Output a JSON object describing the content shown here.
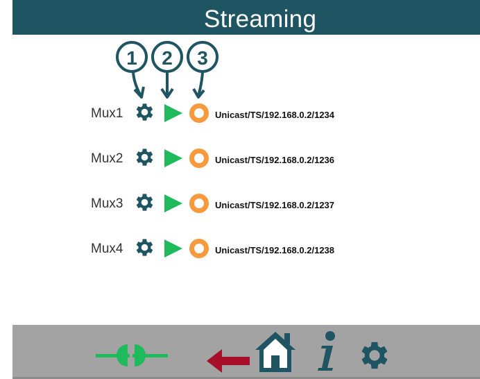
{
  "header": {
    "title": "Streaming"
  },
  "callouts": [
    "1",
    "2",
    "3"
  ],
  "rows": [
    {
      "label": "Mux1",
      "url": "Unicast/TS/192.168.0.2/1234"
    },
    {
      "label": "Mux2",
      "url": "Unicast/TS/192.168.0.2/1236"
    },
    {
      "label": "Mux3",
      "url": "Unicast/TS/192.168.0.2/1237"
    },
    {
      "label": "Mux4",
      "url": "Unicast/TS/192.168.0.2/1238"
    }
  ],
  "icons": {
    "row_settings": "gear-icon",
    "row_play": "play-icon",
    "row_record": "record-icon",
    "footer": [
      "connection-plug-icon",
      "back-arrow-icon",
      "home-icon",
      "info-icon",
      "gear-icon"
    ]
  },
  "colors": {
    "header_bg": "#1f5563",
    "accent_teal": "#1f5563",
    "play_green": "#1fba5c",
    "record_orange": "#f79a3e",
    "back_red": "#a8102a",
    "footer_bg": "#a3a3a3"
  }
}
